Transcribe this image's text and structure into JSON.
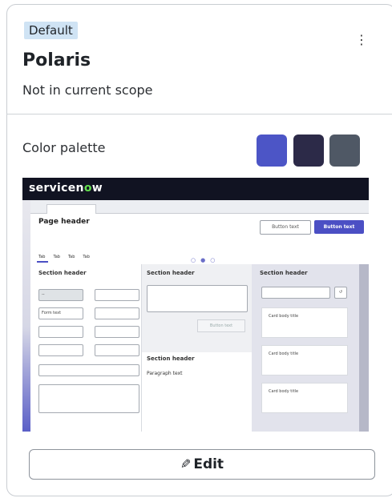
{
  "card": {
    "badge": "Default",
    "more_icon": "more-vertical-icon",
    "title": "Polaris",
    "subtitle": "Not in current scope",
    "palette_label": "Color palette",
    "palette_colors": [
      "#4c55c6",
      "#2c2a48",
      "#4f5865"
    ],
    "edit_label": "Edit",
    "edit_icon": "pencil-icon"
  },
  "preview": {
    "logo_prefix": "servicen",
    "logo_o": "o",
    "logo_suffix": "w",
    "page_header": "Page header",
    "button_outline": "Button text",
    "button_primary": "Button text",
    "tabs": [
      "Tab",
      "Tab",
      "Tab",
      "Tab"
    ],
    "section_header": "Section header",
    "form_dash": "--",
    "form_text": "Form text",
    "button_disabled": "Button text",
    "paragraph": "Paragraph text",
    "card_body_title": "Card body title"
  }
}
